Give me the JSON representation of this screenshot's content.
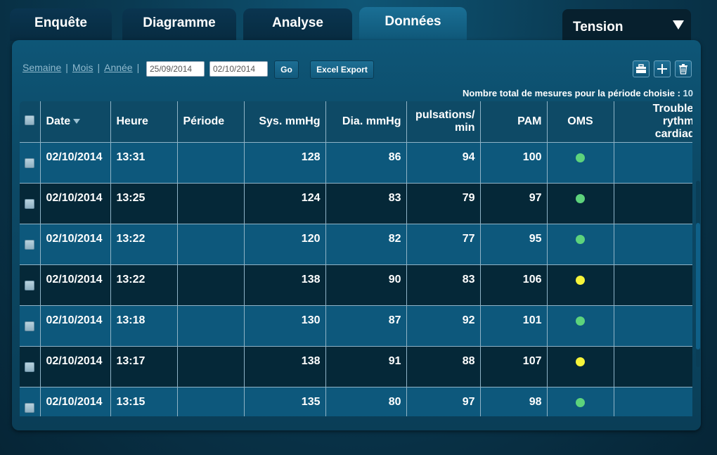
{
  "tabs": [
    {
      "label": "Enquête"
    },
    {
      "label": "Diagramme"
    },
    {
      "label": "Analyse"
    },
    {
      "label": "Données"
    }
  ],
  "measure_select": {
    "label": "Tension"
  },
  "filters": {
    "week": "Semaine",
    "month": "Mois",
    "year": "Année",
    "separator": "|",
    "date_from": "25/09/2014",
    "date_to": "02/10/2014",
    "go_label": "Go",
    "export_label": "Excel Export"
  },
  "toolbar_icons": [
    "briefcase-icon",
    "plus-icon",
    "trash-icon"
  ],
  "total": {
    "label": "Nombre total de mesures pour la période choisie :",
    "value": "10"
  },
  "table": {
    "headers": {
      "date": "Date",
      "heure": "Heure",
      "periode": "Période",
      "sys": "Sys. mmHg",
      "dia": "Dia. mmHg",
      "puls": "pulsations/ min",
      "pam": "PAM",
      "oms": "OMS",
      "trouble": "Trouble du rythme cardiaque"
    },
    "rows": [
      {
        "date": "02/10/2014",
        "heure": "13:31",
        "periode": "",
        "sys": "128",
        "dia": "86",
        "puls": "94",
        "pam": "100",
        "oms": "green"
      },
      {
        "date": "02/10/2014",
        "heure": "13:25",
        "periode": "",
        "sys": "124",
        "dia": "83",
        "puls": "79",
        "pam": "97",
        "oms": "green"
      },
      {
        "date": "02/10/2014",
        "heure": "13:22",
        "periode": "",
        "sys": "120",
        "dia": "82",
        "puls": "77",
        "pam": "95",
        "oms": "green"
      },
      {
        "date": "02/10/2014",
        "heure": "13:22",
        "periode": "",
        "sys": "138",
        "dia": "90",
        "puls": "83",
        "pam": "106",
        "oms": "yellow"
      },
      {
        "date": "02/10/2014",
        "heure": "13:18",
        "periode": "",
        "sys": "130",
        "dia": "87",
        "puls": "92",
        "pam": "101",
        "oms": "green"
      },
      {
        "date": "02/10/2014",
        "heure": "13:17",
        "periode": "",
        "sys": "138",
        "dia": "91",
        "puls": "88",
        "pam": "107",
        "oms": "yellow"
      },
      {
        "date": "02/10/2014",
        "heure": "13:15",
        "periode": "",
        "sys": "135",
        "dia": "80",
        "puls": "97",
        "pam": "98",
        "oms": "green"
      }
    ]
  },
  "colors": {
    "oms_green": "#5dd37c",
    "oms_yellow": "#f6f43a",
    "active_tab": "#1a6f95"
  }
}
